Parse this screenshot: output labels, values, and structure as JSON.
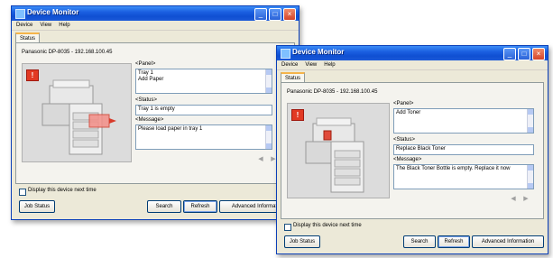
{
  "window1": {
    "title": "Device Monitor",
    "menu": [
      "Device",
      "View",
      "Help"
    ],
    "tab": "Status",
    "device_name": "Panasonic DP-8035 - 192.168.100.45",
    "panel_label": "<Panel>",
    "panel_lines": [
      "Tray 1",
      "Add Paper"
    ],
    "status_label": "<Status>",
    "status_value": "Tray 1 is empty",
    "message_label": "<Message>",
    "message_value": "Please load paper in tray 1",
    "checkbox_label": "Display this device next time",
    "buttons": {
      "job_status": "Job Status",
      "search": "Search",
      "refresh": "Refresh",
      "advanced": "Advanced Information"
    }
  },
  "window2": {
    "title": "Device Monitor",
    "menu": [
      "Device",
      "View",
      "Help"
    ],
    "tab": "Status",
    "device_name": "Panasonic DP-8035 - 192.168.100.45",
    "panel_label": "<Panel>",
    "panel_lines": [
      "Add Toner"
    ],
    "status_label": "<Status>",
    "status_value": "Replace Black Toner",
    "message_label": "<Message>",
    "message_value": "The Black Toner Bottle is empty. Replace it now",
    "checkbox_label": "Display this device next time",
    "buttons": {
      "job_status": "Job Status",
      "search": "Search",
      "refresh": "Refresh",
      "advanced": "Advanced Information"
    }
  },
  "icons": {
    "warning": "warning-icon",
    "nav_prev": "arrow-left-icon",
    "nav_next": "arrow-right-icon",
    "minimize": "minimize-icon",
    "maximize": "maximize-icon",
    "close": "close-icon"
  },
  "glyphs": {
    "warning": "!",
    "minimize": "_",
    "maximize": "□",
    "close": "×",
    "prev": "◀",
    "next": "▶"
  }
}
